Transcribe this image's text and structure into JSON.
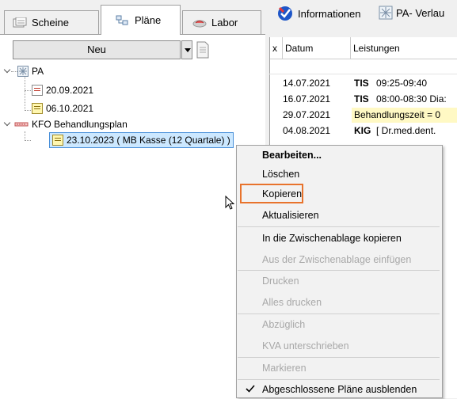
{
  "tabs": [
    {
      "label": "Scheine"
    },
    {
      "label": "Pläne"
    },
    {
      "label": "Labor"
    }
  ],
  "new_button": {
    "label": "Neu"
  },
  "tree": {
    "groups": [
      {
        "label": "PA",
        "children": [
          {
            "label": "20.09.2021"
          },
          {
            "label": "06.10.2021"
          }
        ]
      },
      {
        "label": "KFO Behandlungsplan",
        "children": [
          {
            "label": "23.10.2023 ( MB Kasse (12 Quartale) )"
          }
        ]
      }
    ]
  },
  "toolbar": {
    "informationen": "Informationen",
    "pa_verlauf": "PA- Verlau"
  },
  "grid": {
    "columns": [
      "x",
      "Datum",
      "Leistungen"
    ],
    "rows": [
      {
        "date": "14.07.2021",
        "code": "TIS",
        "text": "09:25-09:40"
      },
      {
        "date": "16.07.2021",
        "code": "TIS",
        "text": "08:00-08:30 Dia:"
      },
      {
        "date": "29.07.2021",
        "code": "",
        "text": "Behandlungszeit = 0"
      },
      {
        "date": "04.08.2021",
        "code": "KIG",
        "text": "[ Dr.med.dent."
      }
    ]
  },
  "context_menu": {
    "items": [
      {
        "label": "Bearbeiten...",
        "enabled": true,
        "bold": true
      },
      {
        "label": "Löschen",
        "enabled": true
      },
      {
        "label": "Kopieren",
        "enabled": true,
        "highlighted": true
      },
      {
        "label": "Aktualisieren",
        "enabled": true
      },
      {
        "label": "In die Zwischenablage kopieren",
        "enabled": true
      },
      {
        "label": "Aus der Zwischenablage einfügen",
        "enabled": false
      },
      {
        "label": "Drucken",
        "enabled": false
      },
      {
        "label": "Alles drucken",
        "enabled": false
      },
      {
        "label": "Abzüglich",
        "enabled": false
      },
      {
        "label": "KVA unterschrieben",
        "enabled": false
      },
      {
        "label": "Markieren",
        "enabled": false
      },
      {
        "label": "Abgeschlossene Pläne ausblenden",
        "enabled": true,
        "checked": true
      }
    ]
  },
  "colors": {
    "highlight_border": "#e8732c",
    "selection": "#cce8ff",
    "yellow_row": "#fff9c4"
  }
}
